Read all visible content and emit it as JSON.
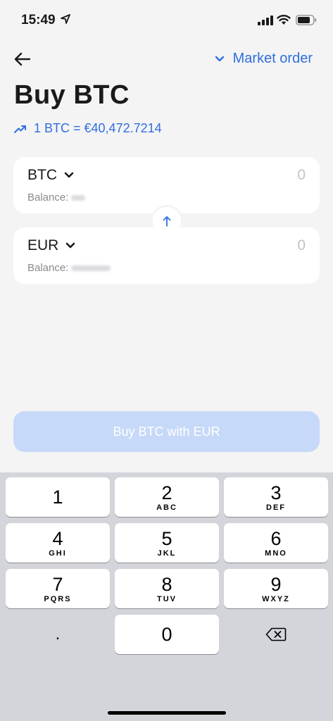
{
  "status_bar": {
    "time": "15:49"
  },
  "header": {
    "order_type": "Market order"
  },
  "page": {
    "title": "Buy BTC",
    "rate": "1 BTC = €40,472.7214"
  },
  "from": {
    "currency": "BTC",
    "amount_placeholder": "0",
    "balance_label": "Balance:"
  },
  "to": {
    "currency": "EUR",
    "amount_placeholder": "0",
    "balance_label": "Balance:"
  },
  "action": {
    "label": "Buy BTC with EUR",
    "enabled": false
  },
  "keypad": {
    "keys": [
      {
        "digit": "1",
        "letters": ""
      },
      {
        "digit": "2",
        "letters": "ABC"
      },
      {
        "digit": "3",
        "letters": "DEF"
      },
      {
        "digit": "4",
        "letters": "GHI"
      },
      {
        "digit": "5",
        "letters": "JKL"
      },
      {
        "digit": "6",
        "letters": "MNO"
      },
      {
        "digit": "7",
        "letters": "PQRS"
      },
      {
        "digit": "8",
        "letters": "TUV"
      },
      {
        "digit": "9",
        "letters": "WXYZ"
      },
      {
        "digit": "0",
        "letters": ""
      }
    ],
    "decimal": "."
  },
  "colors": {
    "accent": "#2f6fe0",
    "disabled_button": "#c7d9f8",
    "background": "#f4f4f5",
    "keyboard": "#d3d5db"
  }
}
